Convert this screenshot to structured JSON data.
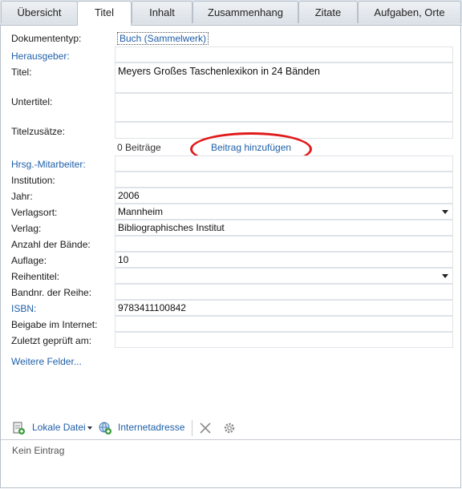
{
  "tabs": [
    {
      "label": "Übersicht"
    },
    {
      "label": "Titel"
    },
    {
      "label": "Inhalt"
    },
    {
      "label": "Zusammenhang"
    },
    {
      "label": "Zitate"
    },
    {
      "label": "Aufgaben, Orte"
    }
  ],
  "active_tab": "Titel",
  "document_type": {
    "label": "Dokumententyp:",
    "value": "Buch (Sammelwerk)"
  },
  "fields": {
    "herausgeber": {
      "label": "Herausgeber:",
      "value": ""
    },
    "titel": {
      "label": "Titel:",
      "value": "Meyers Großes Taschenlexikon in 24 Bänden"
    },
    "untertitel": {
      "label": "Untertitel:",
      "value": ""
    },
    "titelzusaetze": {
      "label": "Titelzusätze:",
      "value": ""
    },
    "hrsg_mitarbeiter": {
      "label": "Hrsg.-Mitarbeiter:",
      "value": ""
    },
    "institution": {
      "label": "Institution:",
      "value": ""
    },
    "jahr": {
      "label": "Jahr:",
      "value": "2006"
    },
    "verlagsort": {
      "label": "Verlagsort:",
      "value": "Mannheim"
    },
    "verlag": {
      "label": "Verlag:",
      "value": "Bibliographisches Institut"
    },
    "anzahl_baende": {
      "label": "Anzahl der Bände:",
      "value": ""
    },
    "auflage": {
      "label": "Auflage:",
      "value": "10"
    },
    "reihentitel": {
      "label": "Reihentitel:",
      "value": ""
    },
    "bandnr_reihe": {
      "label": "Bandnr. der Reihe:",
      "value": ""
    },
    "isbn": {
      "label": "ISBN:",
      "value": "9783411100842"
    },
    "beigabe_internet": {
      "label": "Beigabe im Internet:",
      "value": ""
    },
    "zuletzt_geprueft": {
      "label": "Zuletzt geprüft am:",
      "value": ""
    }
  },
  "contributions": {
    "count_text": "0 Beiträge",
    "add_label": "Beitrag hinzufügen"
  },
  "more_fields_label": "Weitere Felder...",
  "toolbar": {
    "local_file_label": "Lokale Datei",
    "internet_address_label": "Internetadresse"
  },
  "empty_text": "Kein Eintrag",
  "colors": {
    "link": "#1f5fa8",
    "highlight_ellipse": "#e11a1a",
    "tab_bar": "#dfe4ea"
  }
}
